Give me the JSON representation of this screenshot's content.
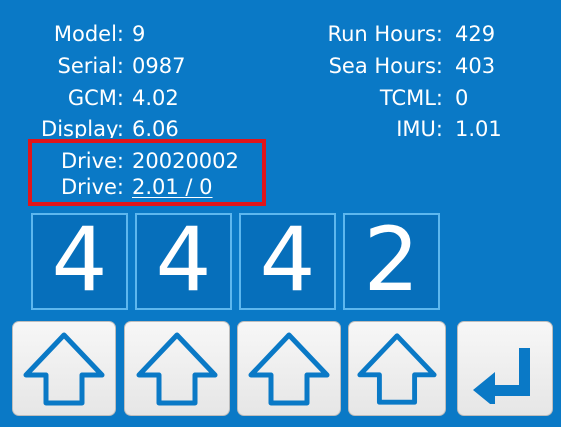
{
  "info_left": [
    {
      "label": "Model:",
      "value": "9"
    },
    {
      "label": "Serial:",
      "value": "0987"
    },
    {
      "label": "GCM:",
      "value": "4.02"
    },
    {
      "label": "Display:",
      "value": "6.06"
    },
    {
      "label": "Drive:",
      "value": "20020002"
    },
    {
      "label": "Drive:",
      "value": "2.01 / 0"
    }
  ],
  "info_right": [
    {
      "label": "Run Hours:",
      "value": "429"
    },
    {
      "label": "Sea Hours:",
      "value": "403"
    },
    {
      "label": "TCML:",
      "value": "0"
    },
    {
      "label": "IMU:",
      "value": "1.01"
    }
  ],
  "digits": [
    "4",
    "4",
    "4",
    "2"
  ],
  "icons": {
    "up": "up-arrow-icon",
    "enter": "enter-return-icon"
  },
  "colors": {
    "background": "#0a79c6",
    "highlight": "#e0151b",
    "digit_border": "#5db7ee",
    "icon_blue": "#0a79c6"
  }
}
